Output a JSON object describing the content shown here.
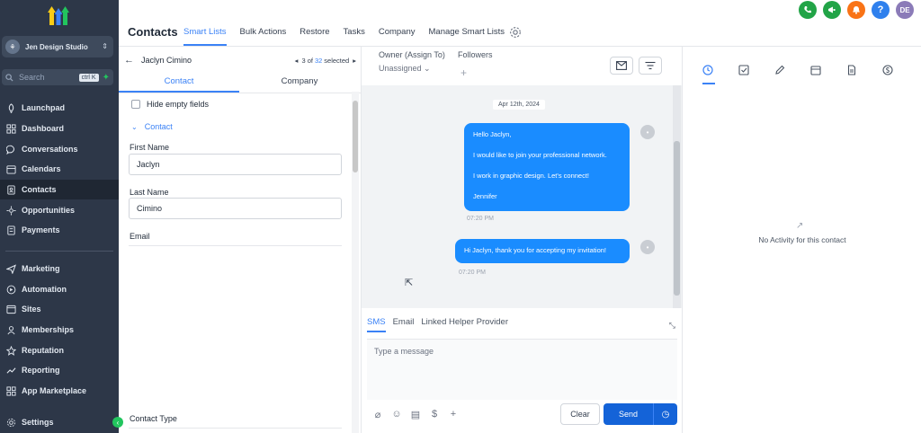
{
  "sidebar": {
    "account_name": "Jen Design Studio",
    "search_placeholder": "Search",
    "search_shortcut": "ctrl K",
    "nav_top": [
      {
        "label": "Launchpad",
        "icon": "rocket-icon"
      },
      {
        "label": "Dashboard",
        "icon": "dashboard-icon"
      },
      {
        "label": "Conversations",
        "icon": "chat-icon"
      },
      {
        "label": "Calendars",
        "icon": "calendar-icon"
      },
      {
        "label": "Contacts",
        "icon": "contacts-icon"
      },
      {
        "label": "Opportunities",
        "icon": "opportunities-icon"
      },
      {
        "label": "Payments",
        "icon": "payments-icon"
      }
    ],
    "nav_bottom": [
      {
        "label": "Marketing",
        "icon": "send-icon"
      },
      {
        "label": "Automation",
        "icon": "automation-icon"
      },
      {
        "label": "Sites",
        "icon": "sites-icon"
      },
      {
        "label": "Memberships",
        "icon": "memberships-icon"
      },
      {
        "label": "Reputation",
        "icon": "star-icon"
      },
      {
        "label": "Reporting",
        "icon": "reporting-icon"
      },
      {
        "label": "App Marketplace",
        "icon": "marketplace-icon"
      }
    ],
    "settings_label": "Settings"
  },
  "header": {
    "title": "Contacts",
    "tabs": [
      "Smart Lists",
      "Bulk Actions",
      "Restore",
      "Tasks",
      "Company",
      "Manage Smart Lists"
    ],
    "user_initials": "DE",
    "help_label": "?"
  },
  "contact_panel": {
    "name": "Jaclyn Cimino",
    "pager": {
      "current": "3 of",
      "total": "32",
      "suffix": "selected"
    },
    "tabs": [
      "Contact",
      "Company"
    ],
    "hide_empty_label": "Hide empty fields",
    "section_label": "Contact",
    "first_name_label": "First Name",
    "first_name_value": "Jaclyn",
    "last_name_label": "Last Name",
    "last_name_value": "Cimino",
    "email_label": "Email",
    "contact_type_label": "Contact Type"
  },
  "conversation": {
    "owner_label": "Owner (Assign To)",
    "owner_value": "Unassigned",
    "followers_label": "Followers",
    "date_chip": "Apr 12th, 2024",
    "messages": [
      {
        "lines": [
          "Hello Jaclyn,",
          "I would like to join your professional network.",
          "I work in graphic design. Let's connect!",
          "Jennifer"
        ],
        "time": "07:20 PM"
      },
      {
        "lines": [
          "Hi Jaclyn, thank you for accepting my invitation!"
        ],
        "time": "07:20 PM"
      }
    ],
    "channels": [
      "SMS",
      "Email",
      "Linked Helper Provider"
    ],
    "message_placeholder": "Type a message",
    "clear_label": "Clear",
    "send_label": "Send"
  },
  "activity": {
    "empty_text": "No Activity for this contact"
  },
  "colors": {
    "sidebar_bg": "#2d3748",
    "accent": "#3b82f6",
    "bubble": "#1a8cff",
    "send": "#1463d8"
  }
}
